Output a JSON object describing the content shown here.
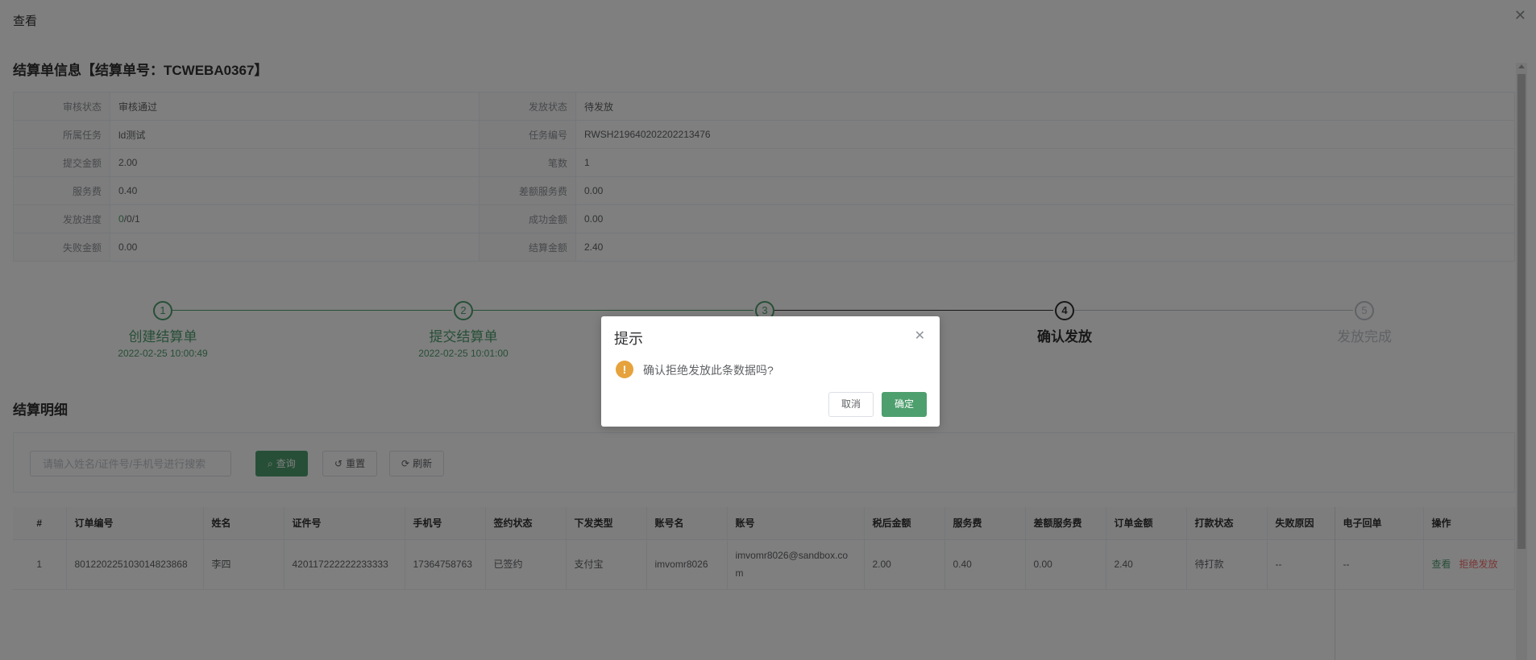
{
  "page": {
    "title": "查看"
  },
  "info": {
    "title": "结算单信息【结算单号：TCWEBA0367】",
    "rows": [
      {
        "l1": "审核状态",
        "v1": "审核通过",
        "l2": "发放状态",
        "v2": "待发放"
      },
      {
        "l1": "所属任务",
        "v1": "ld测试",
        "l2": "任务编号",
        "v2": "RWSH219640202202213476"
      },
      {
        "l1": "提交金额",
        "v1": "2.00",
        "l2": "笔数",
        "v2": "1"
      },
      {
        "l1": "服务费",
        "v1": "0.40",
        "l2": "差额服务费",
        "v2": "0.00"
      },
      {
        "l1": "发放进度",
        "v1_green": "0",
        "v1_rest": "/0/1",
        "l2": "成功金额",
        "v2": "0.00"
      },
      {
        "l1": "失败金额",
        "v1": "0.00",
        "l2": "结算金额",
        "v2": "2.40"
      }
    ]
  },
  "steps": [
    {
      "num": "1",
      "title": "创建结算单",
      "time": "2022-02-25 10:00:49",
      "status": "finish"
    },
    {
      "num": "2",
      "title": "提交结算单",
      "time": "2022-02-25 10:01:00",
      "status": "finish"
    },
    {
      "num": "3",
      "title": "",
      "time": "",
      "status": "finish"
    },
    {
      "num": "4",
      "title": "确认发放",
      "time": "",
      "status": "process"
    },
    {
      "num": "5",
      "title": "发放完成",
      "time": "",
      "status": "wait"
    }
  ],
  "detail": {
    "title": "结算明细",
    "search_placeholder": "请输入姓名/证件号/手机号进行搜索",
    "query_label": "查询",
    "reset_label": "重置",
    "refresh_label": "刷新"
  },
  "table": {
    "headers": [
      "#",
      "订单编号",
      "姓名",
      "证件号",
      "手机号",
      "签约状态",
      "下发类型",
      "账号名",
      "账号",
      "税后金额",
      "服务费",
      "差额服务费",
      "订单金额",
      "打款状态",
      "失败原因",
      "电子回单",
      "操作"
    ],
    "rows": [
      {
        "idx": "1",
        "order_no": "80122022510301482386​8",
        "name": "李四",
        "id_no": "420117222222233333",
        "phone": "17364758763",
        "sign_status": "已签约",
        "pay_type": "支付宝",
        "account_name": "imvomr8026",
        "account": "imvomr8026@sandbox.com",
        "after_tax": "2.00",
        "service_fee": "0.40",
        "diff_fee": "0.00",
        "order_amount": "2.40",
        "pay_status": "待打款",
        "fail_reason": "--",
        "receipt": "--",
        "op_view": "查看",
        "op_reject": "拒绝发放"
      }
    ]
  },
  "dialog": {
    "title": "提示",
    "message": "确认拒绝发放此条数据吗?",
    "cancel_label": "取消",
    "ok_label": "确定"
  },
  "colors": {
    "primary": "#4e9f6e",
    "warning": "#e6a23c",
    "danger": "#f56c6c"
  }
}
